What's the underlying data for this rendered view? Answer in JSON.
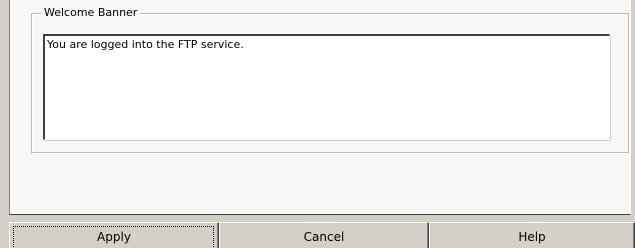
{
  "welcome_banner": {
    "label": "Welcome Banner",
    "text": "You are logged into the FTP service."
  },
  "buttons": {
    "apply": "Apply",
    "cancel": "Cancel",
    "help": "Help"
  },
  "colors": {
    "dialog_face": "#d4d0c8",
    "tab_face": "#f7f7f5",
    "textarea_bg": "#ffffff"
  }
}
